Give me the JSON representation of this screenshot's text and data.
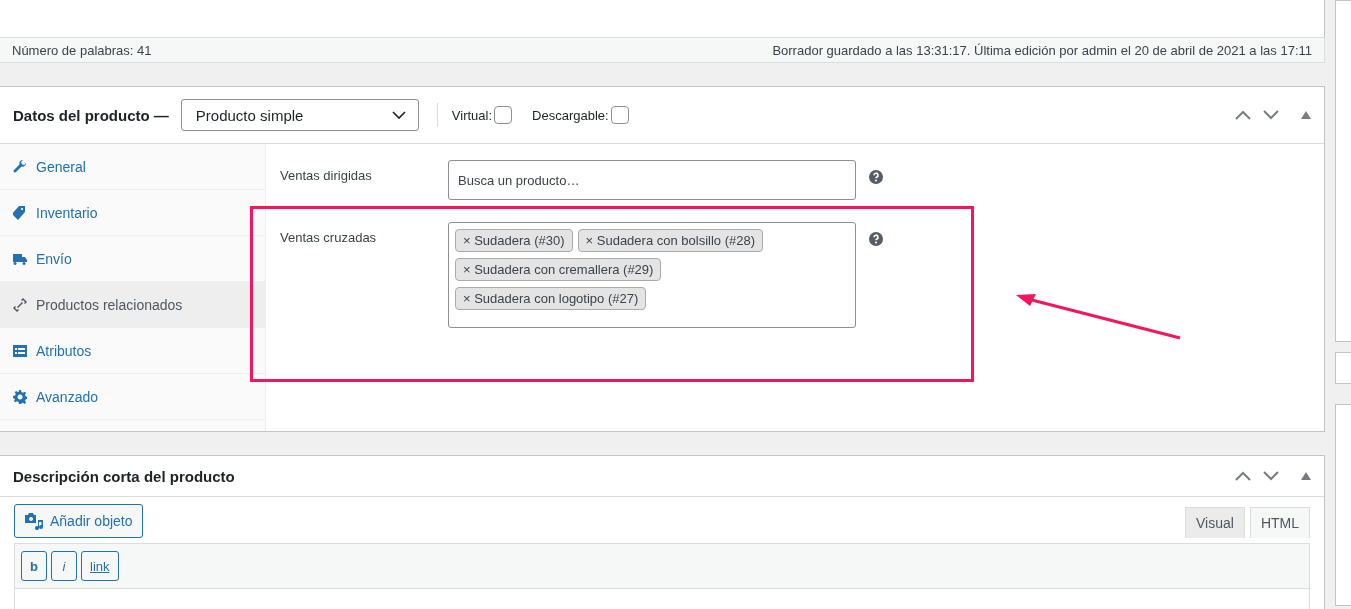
{
  "status_bar": {
    "word_count": "Número de palabras: 41",
    "draft_info": "Borrador guardado a las 13:31:17. Última edición por admin el 20 de abril de 2021 a las 17:11"
  },
  "product_data": {
    "title": "Datos del producto —",
    "type_select": "Producto simple",
    "options": [
      {
        "label": "Virtual:",
        "checked": false
      },
      {
        "label": "Descargable:",
        "checked": false
      }
    ],
    "tabs": [
      {
        "label": "General",
        "kind": "wrench",
        "selected": false
      },
      {
        "label": "Inventario",
        "kind": "tag",
        "selected": false
      },
      {
        "label": "Envío",
        "kind": "truck",
        "selected": false
      },
      {
        "label": "Productos relacionados",
        "kind": "link",
        "selected": true
      },
      {
        "label": "Atributos",
        "kind": "list",
        "selected": false
      },
      {
        "label": "Avanzado",
        "kind": "gear",
        "selected": false
      }
    ],
    "upsells": {
      "label": "Ventas dirigidas",
      "placeholder": "Busca un producto…"
    },
    "cross_sells": {
      "label": "Ventas cruzadas",
      "tags": [
        "× Sudadera (#30)",
        "× Sudadera con bolsillo (#28)",
        "× Sudadera con cremallera (#29)",
        "× Sudadera con logotipo (#27)"
      ]
    }
  },
  "short_description": {
    "title": "Descripción corta del producto",
    "add_media": "Añadir objeto",
    "editor_tabs": [
      {
        "label": "Visual",
        "selected": false
      },
      {
        "label": "HTML",
        "selected": true
      }
    ],
    "quicktags": [
      "b",
      "i",
      "link"
    ]
  }
}
